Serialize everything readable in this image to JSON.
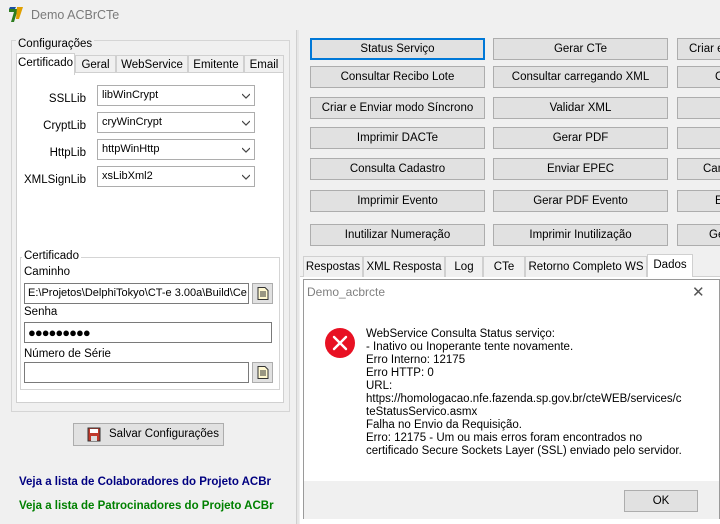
{
  "window": {
    "title": "Demo ACBrCTe"
  },
  "config": {
    "group_label": "Configurações",
    "tabs": [
      "Certificado",
      "Geral",
      "WebService",
      "Emitente",
      "Email"
    ],
    "ssllib": {
      "label": "SSLLib",
      "value": "libWinCrypt"
    },
    "cryptlib": {
      "label": "CryptLib",
      "value": "cryWinCrypt"
    },
    "httplib": {
      "label": "HttpLib",
      "value": "httpWinHttp"
    },
    "xmlsignlib": {
      "label": "XMLSignLib",
      "value": "xsLibXml2"
    },
    "cert": {
      "group_label": "Certificado",
      "path_label": "Caminho",
      "path_value": "E:\\Projetos\\DelphiTokyo\\CT-e 3.00a\\Build\\Ce",
      "password_label": "Senha",
      "password_value": "●●●●●●●●●",
      "serial_label": "Número de Série",
      "serial_value": ""
    },
    "save_button": "Salvar Configurações"
  },
  "links": {
    "colaboradores": "Veja a lista de Colaboradores do Projeto ACBr",
    "patrocinadores": "Veja a lista de Patrocinadores do Projeto ACBr",
    "colaboradores_color": "#000080",
    "patrocinadores_color": "#008000"
  },
  "actions": {
    "col1": [
      "Status Serviço",
      "Consultar Recibo Lote",
      "Criar e Enviar modo Síncrono",
      "Imprimir DACTe",
      "Consulta Cadastro",
      "Imprimir Evento",
      "Inutilizar Numeração"
    ],
    "col2": [
      "Gerar CTe",
      "Consultar carregando XML",
      "Validar XML",
      "Gerar PDF",
      "Enviar EPEC",
      "Gerar PDF Evento",
      "Imprimir Inutilização"
    ],
    "col3": [
      "Criar e",
      "C",
      "",
      "",
      "Can",
      "E",
      "Ge"
    ]
  },
  "result_tabs": [
    "Respostas",
    "XML Resposta",
    "Log",
    "CTe",
    "Retorno Completo WS",
    "Dados"
  ],
  "dialog": {
    "title": "Demo_acbrcte",
    "close_glyph": "✕",
    "error_color": "#e81123",
    "message_lines": [
      "WebService Consulta Status serviço:",
      "- Inativo ou Inoperante tente novamente.",
      "Erro Interno: 12175",
      "Erro HTTP: 0",
      "URL:",
      "https://homologacao.nfe.fazenda.sp.gov.br/cteWEB/services/c",
      "teStatusServico.asmx",
      "Falha no Envio da Requisição.",
      "Erro: 12175 - Um ou mais erros foram encontrados no",
      "certificado Secure Sockets Layer (SSL) enviado pelo servidor."
    ],
    "ok_label": "OK"
  }
}
